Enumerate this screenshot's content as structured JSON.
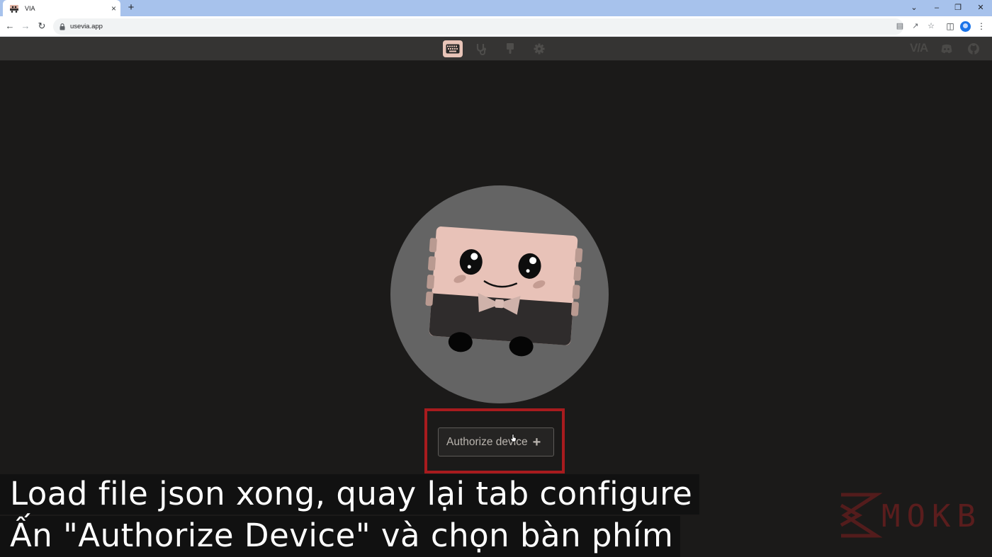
{
  "browser": {
    "tab_title": "VIA",
    "tab_close": "×",
    "new_tab": "+",
    "url": "usevia.app",
    "window_controls": {
      "list": "⌄",
      "minimize": "–",
      "restore": "❐",
      "close": "✕"
    }
  },
  "app": {
    "nav": [
      {
        "name": "configure",
        "icon": "keyboard-icon",
        "active": true
      },
      {
        "name": "test",
        "icon": "stethoscope-icon",
        "active": false
      },
      {
        "name": "design",
        "icon": "brush-icon",
        "active": false
      },
      {
        "name": "settings",
        "icon": "gear-icon",
        "active": false
      }
    ],
    "brand": "V/A",
    "external_links": [
      "discord-icon",
      "github-icon"
    ],
    "authorize_button": {
      "label": "Authorize device",
      "icon": "+"
    },
    "colors": {
      "accent": "#e8c4b8",
      "highlight_border": "#a81b1e",
      "background": "#1b1a19"
    }
  },
  "captions": {
    "line1": "Load file json xong, quay lại tab configure",
    "line2": "Ấn \"Authorize Device\" và chọn bàn phím"
  },
  "watermark": {
    "text": "MOKB"
  }
}
